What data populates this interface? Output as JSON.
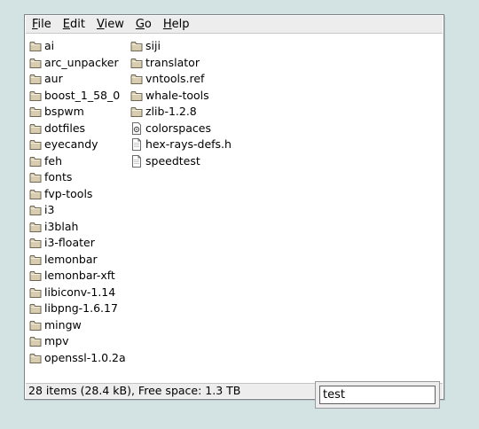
{
  "menubar": {
    "items": [
      {
        "mnemonic": "F",
        "rest": "ile"
      },
      {
        "mnemonic": "E",
        "rest": "dit"
      },
      {
        "mnemonic": "V",
        "rest": "iew"
      },
      {
        "mnemonic": "G",
        "rest": "o"
      },
      {
        "mnemonic": "H",
        "rest": "elp"
      }
    ]
  },
  "files": {
    "column1": [
      {
        "name": "ai",
        "icon": "folder-icon"
      },
      {
        "name": "arc_unpacker",
        "icon": "folder-icon"
      },
      {
        "name": "aur",
        "icon": "folder-icon"
      },
      {
        "name": "boost_1_58_0",
        "icon": "folder-icon"
      },
      {
        "name": "bspwm",
        "icon": "folder-icon"
      },
      {
        "name": "dotfiles",
        "icon": "folder-icon"
      },
      {
        "name": "eyecandy",
        "icon": "folder-icon"
      },
      {
        "name": "feh",
        "icon": "folder-icon"
      },
      {
        "name": "fonts",
        "icon": "folder-icon"
      },
      {
        "name": "fvp-tools",
        "icon": "folder-icon"
      },
      {
        "name": "i3",
        "icon": "folder-icon"
      },
      {
        "name": "i3blah",
        "icon": "folder-icon"
      },
      {
        "name": "i3-floater",
        "icon": "folder-icon"
      },
      {
        "name": "lemonbar",
        "icon": "folder-icon"
      },
      {
        "name": "lemonbar-xft",
        "icon": "folder-icon"
      },
      {
        "name": "libiconv-1.14",
        "icon": "folder-icon"
      },
      {
        "name": "libpng-1.6.17",
        "icon": "folder-icon"
      },
      {
        "name": "mingw",
        "icon": "folder-icon"
      },
      {
        "name": "mpv",
        "icon": "folder-icon"
      },
      {
        "name": "openssl-1.0.2a",
        "icon": "folder-icon"
      }
    ],
    "column2": [
      {
        "name": "siji",
        "icon": "folder-icon"
      },
      {
        "name": "translator",
        "icon": "folder-icon"
      },
      {
        "name": "vntools.ref",
        "icon": "folder-icon"
      },
      {
        "name": "whale-tools",
        "icon": "folder-icon"
      },
      {
        "name": "zlib-1.2.8",
        "icon": "folder-icon"
      },
      {
        "name": "colorspaces",
        "icon": "settings-file-icon"
      },
      {
        "name": "hex-rays-defs.h",
        "icon": "text-file-icon"
      },
      {
        "name": "speedtest",
        "icon": "text-file-icon"
      }
    ]
  },
  "statusbar": {
    "text": "28 items (28.4 kB), Free space: 1.3 TB"
  },
  "search": {
    "value": "test"
  },
  "colors": {
    "desktop": "#d3e2e2",
    "folder_fill": "#d8cdb0",
    "folder_stroke": "#6e6552",
    "chrome": "#ededed"
  }
}
